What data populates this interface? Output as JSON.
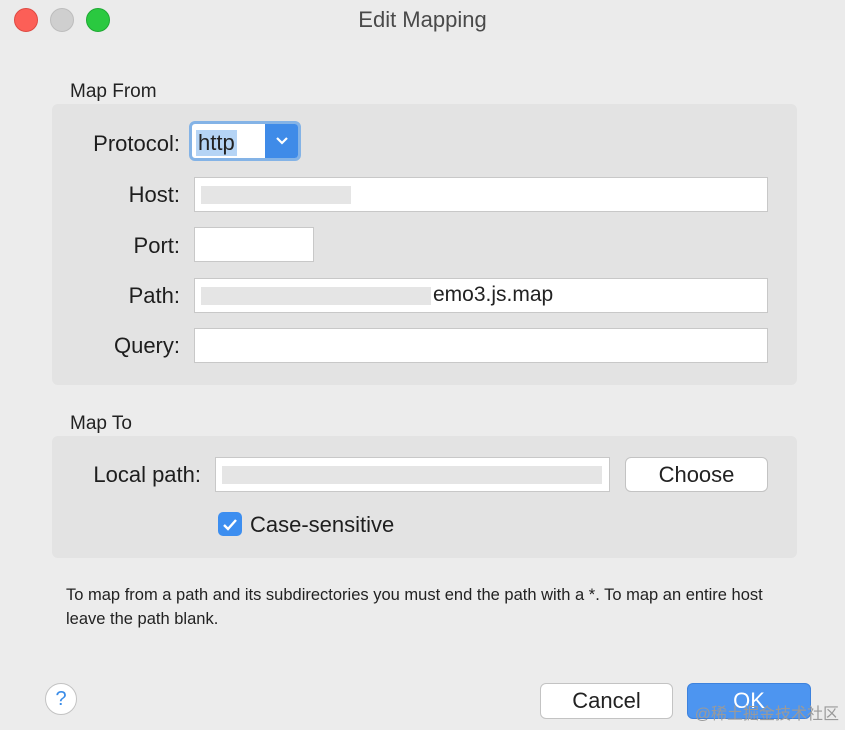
{
  "window": {
    "title": "Edit Mapping"
  },
  "map_from": {
    "section_label": "Map From",
    "protocol_label": "Protocol:",
    "protocol_value": "http",
    "host_label": "Host:",
    "host_value": "",
    "port_label": "Port:",
    "port_value": "",
    "path_label": "Path:",
    "path_value_visible": "emo3.js.map",
    "query_label": "Query:",
    "query_value": ""
  },
  "map_to": {
    "section_label": "Map To",
    "local_path_label": "Local path:",
    "local_path_value": "",
    "choose_label": "Choose",
    "case_sensitive_label": "Case-sensitive",
    "case_sensitive_checked": true
  },
  "note": "To map from a path and its subdirectories you must end the path with a *. To map an entire host leave the path blank.",
  "buttons": {
    "help": "?",
    "cancel": "Cancel",
    "ok": "OK"
  },
  "watermark": "@稀土掘金技术社区",
  "icons": {
    "dropdown": "chevron-down-icon",
    "check": "checkmark-icon",
    "help": "question-icon"
  },
  "colors": {
    "accent": "#3f8be8",
    "close": "#fc5f57",
    "maximize": "#2ac940"
  }
}
